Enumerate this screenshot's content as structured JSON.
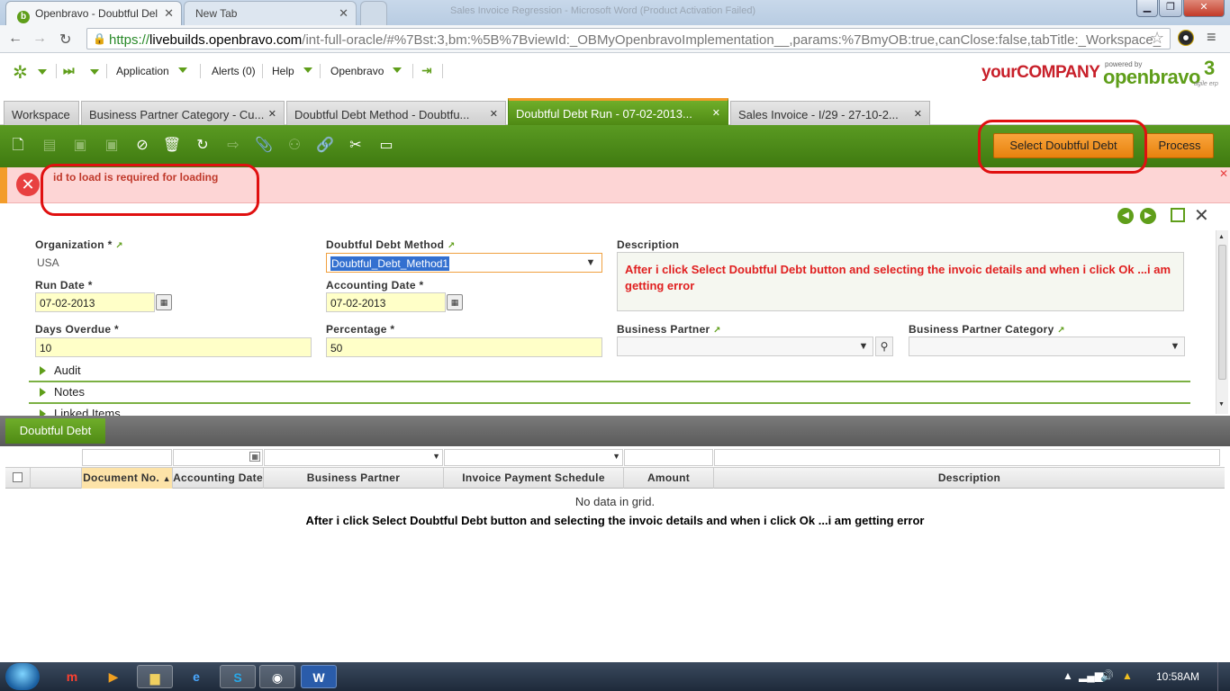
{
  "browser": {
    "tabs": [
      {
        "title": "Openbravo - Doubtful Del",
        "active": true
      },
      {
        "title": "New Tab",
        "active": false
      }
    ],
    "window_title_faded": "Sales Invoice Regression - Microsoft Word (Product Activation Failed)",
    "url": {
      "scheme": "https://",
      "host": "livebuilds.openbravo.com",
      "path": "/int-full-oracle/#%7Bst:3,bm:%5B%7BviewId:_OBMyOpenbravoImplementation__,params:%7BmyOB:true,canClose:false,tabTitle:_Workspace_"
    }
  },
  "app_nav": {
    "application": "Application",
    "alerts": "Alerts (0)",
    "help": "Help",
    "user": "Openbravo",
    "company_logo": "yourCOMPANY",
    "powered_by": "powered by",
    "brand": "openbravo",
    "brand_version": "3",
    "brand_sub": "agile erp"
  },
  "view_tabs": [
    {
      "label": "Workspace",
      "closable": false,
      "active": false
    },
    {
      "label": "Business Partner Category - Cu...",
      "closable": true,
      "active": false
    },
    {
      "label": "Doubtful Debt Method - Doubtfu...",
      "closable": true,
      "active": false
    },
    {
      "label": "Doubtful Debt Run - 07-02-2013...",
      "closable": true,
      "active": true
    },
    {
      "label": "Sales Invoice - I/29 - 27-10-2...",
      "closable": true,
      "active": false
    }
  ],
  "toolbar": {
    "select_btn": "Select Doubtful Debt",
    "process_btn": "Process"
  },
  "error": {
    "message": "id to load is required for loading"
  },
  "form": {
    "organization_label": "Organization *",
    "organization_value": "USA",
    "method_label": "Doubtful Debt Method",
    "method_value": "Doubtful_Debt_Method1",
    "description_label": "Description",
    "description_value": "After i click Select Doubtful Debt button and selecting the invoic details and when i click Ok ...i am getting error",
    "run_date_label": "Run Date *",
    "run_date_value": "07-02-2013",
    "accounting_date_label": "Accounting Date *",
    "accounting_date_value": "07-02-2013",
    "days_overdue_label": "Days Overdue *",
    "days_overdue_value": "10",
    "percentage_label": "Percentage *",
    "percentage_value": "50",
    "bp_label": "Business Partner",
    "bp_category_label": "Business Partner Category",
    "sections": [
      "Audit",
      "Notes",
      "Linked Items"
    ]
  },
  "grid": {
    "tab_label": "Doubtful Debt",
    "columns": [
      "Document No.",
      "Accounting Date",
      "Business Partner",
      "Invoice Payment Schedule",
      "Amount",
      "Description"
    ],
    "empty_message": "No data in grid.",
    "note": "After i click Select Doubtful Debt button and selecting the invoic details and when i click Ok ...i am getting error"
  },
  "taskbar": {
    "clock": "10:58AM"
  },
  "colors": {
    "accent_green": "#5f9e1a",
    "accent_orange": "#f39c2a",
    "error_bg": "#fdd5d5",
    "annotation_red": "#e01010"
  }
}
